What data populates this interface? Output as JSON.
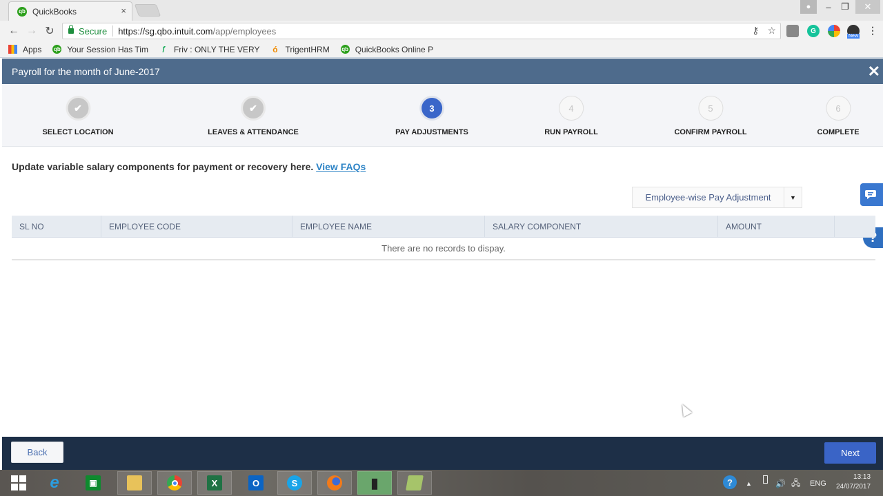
{
  "browser": {
    "tab_title": "QuickBooks",
    "tab_close": "×",
    "secure_label": "Secure",
    "url_host": "https://sg.qbo.intuit.com",
    "url_path": "/app/employees",
    "window_controls": {
      "minimize": "–",
      "maximize": "❐",
      "close": "✕"
    },
    "extensions": {
      "grammarly": "G",
      "new_badge": "New"
    },
    "menu": "⋮",
    "bookmarks": [
      {
        "label": "Apps",
        "icon": "apps-grid-icon"
      },
      {
        "label": "Your Session Has Tim",
        "icon": "quickbooks-icon"
      },
      {
        "label": "Friv : ONLY THE VERY",
        "icon": "friv-icon"
      },
      {
        "label": "TrigentHRM",
        "icon": "trigent-icon"
      },
      {
        "label": "QuickBooks Online P",
        "icon": "quickbooks-icon"
      }
    ]
  },
  "header": {
    "title": "Payroll for the month of June-2017",
    "close_glyph": "✕"
  },
  "stepper": {
    "current_step": 3,
    "steps": [
      {
        "number": "1",
        "label": "SELECT LOCATION",
        "state": "done",
        "glyph": "✔"
      },
      {
        "number": "2",
        "label": "LEAVES & ATTENDANCE",
        "state": "done",
        "glyph": "✔"
      },
      {
        "number": "3",
        "label": "PAY ADJUSTMENTS",
        "state": "active",
        "glyph": "3"
      },
      {
        "number": "4",
        "label": "RUN PAYROLL",
        "state": "todo",
        "glyph": "4"
      },
      {
        "number": "5",
        "label": "CONFIRM PAYROLL",
        "state": "todo",
        "glyph": "5"
      },
      {
        "number": "6",
        "label": "COMPLETE",
        "state": "todo",
        "glyph": "6"
      }
    ]
  },
  "main": {
    "intro_text": "Update variable salary components for payment or recovery here.",
    "faq_link": "View FAQs",
    "adjustment_dropdown": {
      "selected": "Employee-wise Pay Adjustment",
      "caret": "▼"
    },
    "table": {
      "columns": [
        "SL NO",
        "EMPLOYEE CODE",
        "EMPLOYEE NAME",
        "SALARY COMPONENT",
        "AMOUNT",
        ""
      ],
      "rows": [],
      "empty_message": "There are no records to dispay."
    }
  },
  "side_widgets": {
    "chat_glyph": "💬",
    "help_glyph": "?"
  },
  "footer": {
    "back_label": "Back",
    "next_label": "Next"
  },
  "taskbar": {
    "apps": [
      {
        "name": "start",
        "glyph": ""
      },
      {
        "name": "internet-explorer",
        "glyph": "e"
      },
      {
        "name": "store",
        "glyph": "🛍"
      },
      {
        "name": "file-explorer",
        "glyph": "📁"
      },
      {
        "name": "chrome",
        "glyph": "●"
      },
      {
        "name": "excel",
        "glyph": "X"
      },
      {
        "name": "outlook",
        "glyph": "O"
      },
      {
        "name": "skype",
        "glyph": "S"
      },
      {
        "name": "firefox",
        "glyph": "●"
      },
      {
        "name": "camera-app",
        "glyph": "▮"
      },
      {
        "name": "notes-app",
        "glyph": "▰"
      }
    ],
    "tray": {
      "help_glyph": "?",
      "up_glyph": "▲",
      "volume_glyph": "🔊",
      "network_glyph": "🖧",
      "language": "ENG",
      "time": "13:13",
      "date": "24/07/2017"
    }
  }
}
